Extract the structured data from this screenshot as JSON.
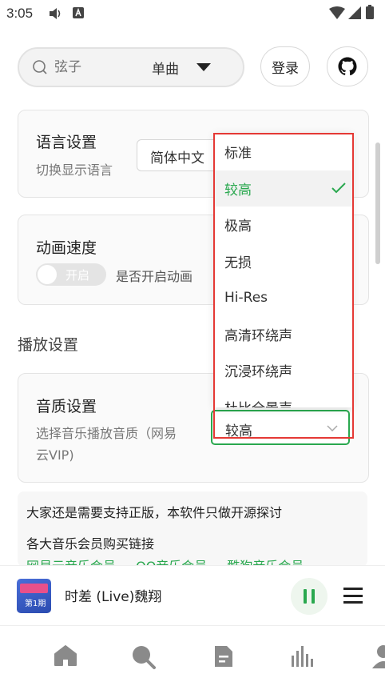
{
  "status_bar": {
    "time": "3:05"
  },
  "search": {
    "placeholder": "弦子",
    "type_label": "单曲"
  },
  "header": {
    "login_label": "登录"
  },
  "language": {
    "title": "语言设置",
    "subtitle": "切换显示语言",
    "value": "简体中文"
  },
  "animation": {
    "title": "动画速度",
    "toggle_label": "开启",
    "description": "是否开启动画"
  },
  "playback": {
    "section_title": "播放设置"
  },
  "quality": {
    "title": "音质设置",
    "subtitle_line1": "选择音乐播放音质（网易",
    "subtitle_line2": "云VIP)",
    "selected": "较高"
  },
  "quality_menu": {
    "items": [
      "标准",
      "较高",
      "极高",
      "无损",
      "Hi-Res",
      "高清环绕声",
      "沉浸环绕声",
      "杜比全景声"
    ],
    "selected_index": 1
  },
  "info": {
    "line1": "大家还是需要支持正版，本软件只做开源探讨",
    "line2": "各大音乐会员购买链接",
    "links": [
      "网易云音乐会员",
      "QQ音乐会员",
      "酷狗音乐会员"
    ]
  },
  "player": {
    "title": "时差 (Live)魏翔",
    "cover_text": "第1期"
  },
  "colors": {
    "accent": "#2aa84f",
    "highlight_border": "#e53935"
  }
}
